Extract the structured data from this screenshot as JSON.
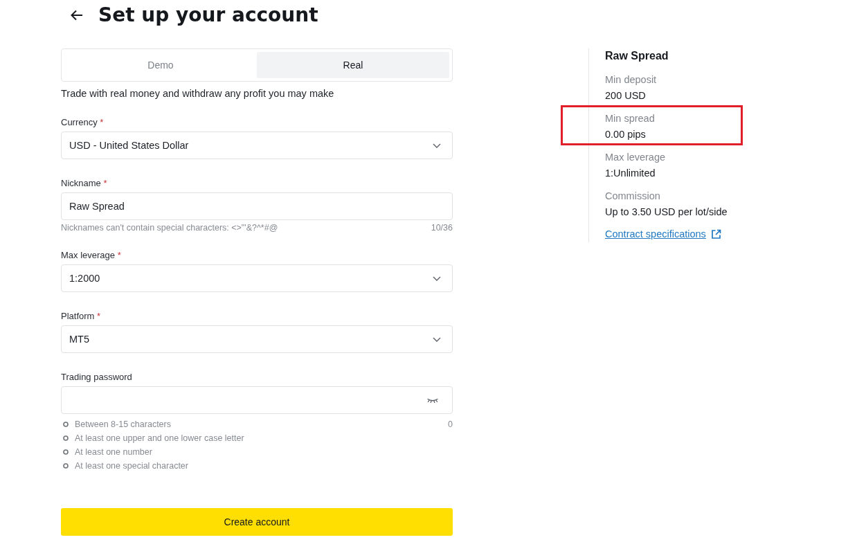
{
  "header": {
    "title": "Set up your account"
  },
  "tabs": [
    {
      "label": "Demo",
      "selected": false
    },
    {
      "label": "Real",
      "selected": true
    }
  ],
  "description": "Trade with real money and withdraw any profit you may make",
  "fields": [
    {
      "kind": "select",
      "label": "Currency",
      "required_mark": "*",
      "value": "USD - United States Dollar"
    },
    {
      "kind": "text",
      "label": "Nickname",
      "required_mark": "*",
      "value": "Raw Spread",
      "hint": "Nicknames can't contain special characters: <>\"'&?^*#@",
      "counter": "10/36"
    },
    {
      "kind": "select",
      "label": "Max leverage",
      "required_mark": "*",
      "value": "1:2000"
    },
    {
      "kind": "select",
      "label": "Platform",
      "required_mark": "*",
      "value": "MT5"
    },
    {
      "kind": "password",
      "label": "Trading password",
      "counter": "0",
      "rules": [
        {
          "text": "Between 8-15 characters",
          "met": false
        },
        {
          "text": "At least one upper and one lower case letter",
          "met": false
        },
        {
          "text": "At least one number",
          "met": false
        },
        {
          "text": "At least one special character",
          "met": false
        }
      ]
    }
  ],
  "submit_button": "Create account",
  "plan": {
    "title": "Raw Spread",
    "specs": [
      {
        "label": "Min deposit",
        "value": "200 USD",
        "highlighted": false
      },
      {
        "label": "Min spread",
        "value": "0.00 pips",
        "highlighted": true
      },
      {
        "label": "Max leverage",
        "value": "1:Unlimited",
        "highlighted": false
      },
      {
        "label": "Commission",
        "value": "Up to 3.50 USD per lot/side",
        "highlighted": false
      }
    ],
    "link": "Contract specifications"
  }
}
